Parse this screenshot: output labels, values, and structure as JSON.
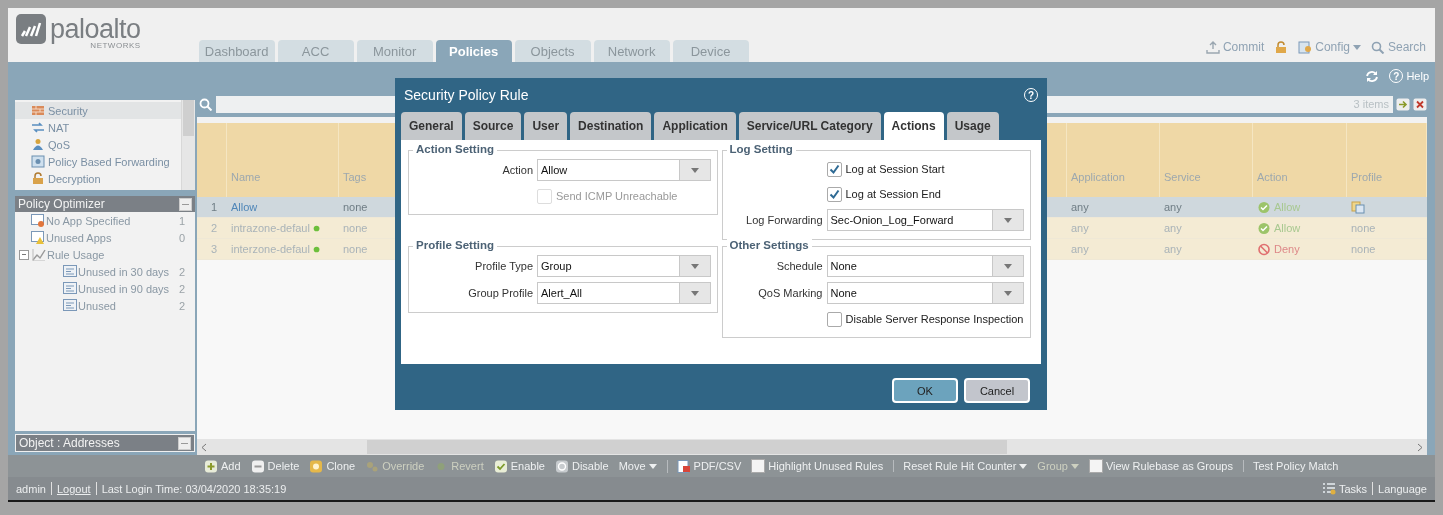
{
  "header": {
    "logo": "paloalto",
    "logo_sub": "NETWORKS",
    "tabs": [
      {
        "label": "Dashboard",
        "selected": false
      },
      {
        "label": "ACC",
        "selected": false
      },
      {
        "label": "Monitor",
        "selected": false
      },
      {
        "label": "Policies",
        "selected": true
      },
      {
        "label": "Objects",
        "selected": false
      },
      {
        "label": "Network",
        "selected": false
      },
      {
        "label": "Device",
        "selected": false
      }
    ],
    "actions": [
      {
        "kind": "commit",
        "label": "Commit"
      },
      {
        "kind": "lock"
      },
      {
        "kind": "config",
        "label": "Config"
      },
      {
        "kind": "search",
        "label": "Search"
      }
    ]
  },
  "subbar": {
    "help_icon": "?",
    "help": "Help"
  },
  "sidebar": {
    "rules": [
      {
        "kind": "security",
        "label": "Security",
        "selected": true
      },
      {
        "kind": "nat",
        "label": "NAT",
        "selected": false
      },
      {
        "kind": "qos",
        "label": "QoS",
        "selected": false
      },
      {
        "kind": "forwarding",
        "label": "Policy Based Forwarding",
        "selected": false
      },
      {
        "kind": "decryption",
        "label": "Decryption",
        "selected": false
      }
    ],
    "optimizer": {
      "title": "Policy Optimizer",
      "items": [
        {
          "kind": "no-app",
          "label": "No App Specified",
          "count": "1"
        },
        {
          "kind": "unused-apps",
          "label": "Unused Apps",
          "count": "0"
        },
        {
          "kind": "usage",
          "label": "Rule Usage",
          "expanded": true,
          "children": [
            {
              "kind": "list",
              "label": "Unused in 30 days",
              "count": "2"
            },
            {
              "kind": "list",
              "label": "Unused in 90 days",
              "count": "2"
            },
            {
              "kind": "list",
              "label": "Unused",
              "count": "2"
            }
          ]
        }
      ]
    },
    "object_bar": "Object : Addresses"
  },
  "table": {
    "count": "3 items",
    "columns": [
      "Name",
      "Tags",
      "Application",
      "Service",
      "Action",
      "Profile"
    ],
    "rows": [
      {
        "num": "1",
        "name": "Allow",
        "kind": "custom",
        "tags": "none",
        "application": "any",
        "service": "any",
        "action": {
          "kind": "allow",
          "label": "Allow"
        },
        "profile": {
          "kind": "group-icon"
        },
        "selected": true
      },
      {
        "num": "2",
        "name": "intrazone-defaul",
        "kind": "default",
        "tags": "none",
        "application": "any",
        "service": "any",
        "action": {
          "kind": "allow",
          "label": "Allow"
        },
        "profile": {
          "kind": "text",
          "label": "none"
        },
        "selected": false
      },
      {
        "num": "3",
        "name": "interzone-defaul",
        "kind": "default",
        "tags": "none",
        "application": "any",
        "service": "any",
        "action": {
          "kind": "deny",
          "label": "Deny"
        },
        "profile": {
          "kind": "text",
          "label": "none"
        },
        "selected": false
      }
    ]
  },
  "toolbar": [
    {
      "kind": "add",
      "label": "Add",
      "disabled": false,
      "separator_before": false
    },
    {
      "kind": "delete",
      "label": "Delete",
      "disabled": false,
      "separator_before": false
    },
    {
      "kind": "clone",
      "label": "Clone",
      "disabled": false,
      "separator_before": false
    },
    {
      "kind": "override",
      "label": "Override",
      "disabled": true,
      "separator_before": false
    },
    {
      "kind": "revert",
      "label": "Revert",
      "disabled": true,
      "separator_before": false
    },
    {
      "kind": "enable",
      "label": "Enable",
      "disabled": false,
      "separator_before": false
    },
    {
      "kind": "disable",
      "label": "Disable",
      "disabled": false,
      "separator_before": false
    },
    {
      "kind": "dropdown",
      "label": "Move",
      "disabled": false,
      "separator_before": false
    },
    {
      "kind": "pdf",
      "label": "PDF/CSV",
      "disabled": false,
      "separator_before": true
    },
    {
      "kind": "checkbox",
      "label": "Highlight Unused Rules",
      "checked": false,
      "disabled": false,
      "separator_before": false
    },
    {
      "kind": "dropdown",
      "label": "Reset Rule Hit Counter",
      "disabled": false,
      "separator_before": true
    },
    {
      "kind": "dropdown",
      "label": "Group",
      "disabled": true,
      "separator_before": false
    },
    {
      "kind": "checkbox",
      "label": "View Rulebase as Groups",
      "checked": false,
      "disabled": false,
      "separator_before": false
    },
    {
      "kind": "plain",
      "label": "Test Policy Match",
      "disabled": false,
      "separator_before": true
    }
  ],
  "status_bar": {
    "user": "admin",
    "logout": "Logout",
    "last_login": "Last Login Time: 03/04/2020 18:35:19",
    "tasks": "Tasks",
    "language": "Language"
  },
  "dialog": {
    "title": "Security Policy Rule",
    "help_icon": "?",
    "tabs": [
      {
        "label": "General",
        "selected": false
      },
      {
        "label": "Source",
        "selected": false
      },
      {
        "label": "User",
        "selected": false
      },
      {
        "label": "Destination",
        "selected": false
      },
      {
        "label": "Application",
        "selected": false
      },
      {
        "label": "Service/URL Category",
        "selected": false
      },
      {
        "label": "Actions",
        "selected": true
      },
      {
        "label": "Usage",
        "selected": false
      }
    ],
    "sections": [
      {
        "title": "Action Setting",
        "fields": [
          {
            "kind": "select",
            "label": "Action",
            "value": "Allow"
          },
          {
            "kind": "checkbox",
            "label": "Send ICMP Unreachable",
            "checked": false,
            "disabled": true
          }
        ]
      },
      {
        "title": "Log Setting",
        "fields": [
          {
            "kind": "checkbox",
            "label": "Log at Session Start",
            "checked": true,
            "disabled": false
          },
          {
            "kind": "checkbox",
            "label": "Log at Session End",
            "checked": true,
            "disabled": false
          },
          {
            "kind": "select",
            "label": "Log Forwarding",
            "value": "Sec-Onion_Log_Forward"
          }
        ]
      },
      {
        "title": "Profile Setting",
        "fields": [
          {
            "kind": "select",
            "label": "Profile Type",
            "value": "Group"
          },
          {
            "kind": "select",
            "label": "Group Profile",
            "value": "Alert_All"
          }
        ]
      },
      {
        "title": "Other Settings",
        "fields": [
          {
            "kind": "select",
            "label": "Schedule",
            "value": "None"
          },
          {
            "kind": "select",
            "label": "QoS Marking",
            "value": "None"
          },
          {
            "kind": "checkbox",
            "label": "Disable Server Response Inspection",
            "checked": false,
            "disabled": false
          }
        ]
      }
    ],
    "buttons": [
      {
        "kind": "primary",
        "label": "OK"
      },
      {
        "kind": "secondary",
        "label": "Cancel"
      }
    ]
  }
}
